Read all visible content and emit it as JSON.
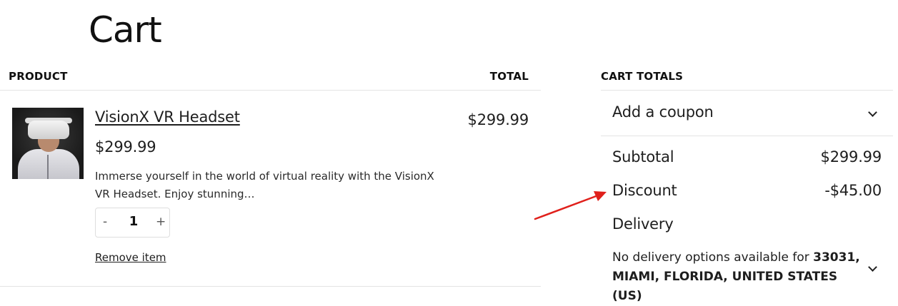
{
  "page": {
    "title": "Cart"
  },
  "table": {
    "product_header": "PRODUCT",
    "total_header": "TOTAL"
  },
  "item": {
    "name": "VisionX VR Headset",
    "price": "$299.99",
    "description": "Immerse yourself in the world of virtual reality with the VisionX VR Headset. Enjoy stunning…",
    "quantity": "1",
    "minus_label": "-",
    "plus_label": "+",
    "remove_label": "Remove item",
    "line_total": "$299.99"
  },
  "totals": {
    "header": "CART TOTALS",
    "coupon_label": "Add a coupon",
    "subtotal_label": "Subtotal",
    "subtotal_value": "$299.99",
    "discount_label": "Discount",
    "discount_value": "-$45.00",
    "delivery_label": "Delivery",
    "delivery_prefix": "No delivery options available for ",
    "delivery_location": "33031, MIAMI, FLORIDA, UNITED STATES (US)"
  },
  "annotation": {
    "arrow_color": "#e0201b"
  }
}
